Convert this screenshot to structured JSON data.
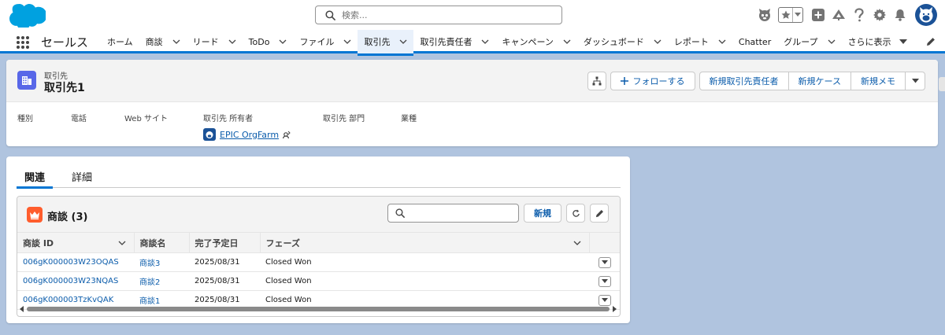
{
  "header": {
    "search_placeholder": "検索...",
    "icons": [
      "cloud-logo",
      "einstein-icon",
      "favorite-star-icon",
      "favorite-dropdown-icon",
      "add-icon",
      "trailhead-icon",
      "help-icon",
      "setup-gear-icon",
      "notifications-bell-icon",
      "user-avatar"
    ]
  },
  "nav": {
    "app_name": "セールス",
    "items": [
      {
        "label": "ホーム",
        "dropdown": false
      },
      {
        "label": "商談",
        "dropdown": true
      },
      {
        "label": "リード",
        "dropdown": true
      },
      {
        "label": "ToDo",
        "dropdown": true
      },
      {
        "label": "ファイル",
        "dropdown": true
      },
      {
        "label": "取引先",
        "dropdown": true,
        "active": true
      },
      {
        "label": "取引先責任者",
        "dropdown": true
      },
      {
        "label": "キャンペーン",
        "dropdown": true
      },
      {
        "label": "ダッシュボード",
        "dropdown": true
      },
      {
        "label": "レポート",
        "dropdown": true
      },
      {
        "label": "Chatter",
        "dropdown": false
      },
      {
        "label": "グループ",
        "dropdown": true
      }
    ],
    "more_label": "さらに表示"
  },
  "record": {
    "type_label": "取引先",
    "name": "取引先1",
    "actions": {
      "follow": "フォローする",
      "new_contact": "新規取引先責任者",
      "new_case": "新規ケース",
      "new_note": "新規メモ"
    },
    "fields": {
      "type_label": "種別",
      "phone_label": "電話",
      "website_label": "Web サイト",
      "owner_label": "取引先 所有者",
      "owner_value": "EPIC OrgFarm",
      "division_label": "取引先 部門",
      "industry_label": "業種"
    }
  },
  "tabs": {
    "related": "関連",
    "details": "詳細"
  },
  "related_list": {
    "title": "商談 (3)",
    "new_label": "新規",
    "columns": [
      "商談 ID",
      "商談名",
      "完了予定日",
      "フェーズ"
    ],
    "rows": [
      {
        "id": "006gK000003W23OQAS",
        "name": "商談3",
        "close_date": "2025/08/31",
        "stage": "Closed Won"
      },
      {
        "id": "006gK000003W23NQAS",
        "name": "商談2",
        "close_date": "2025/08/31",
        "stage": "Closed Won"
      },
      {
        "id": "006gK000003TzKvQAK",
        "name": "商談1",
        "close_date": "2025/08/31",
        "stage": "Closed Won"
      }
    ]
  },
  "colors": {
    "brand_blue": "#0176d3",
    "link_blue": "#0b5cab",
    "account_icon": "#5867e8",
    "opportunity_icon": "#ff5d2d",
    "background": "#b0c4df"
  }
}
